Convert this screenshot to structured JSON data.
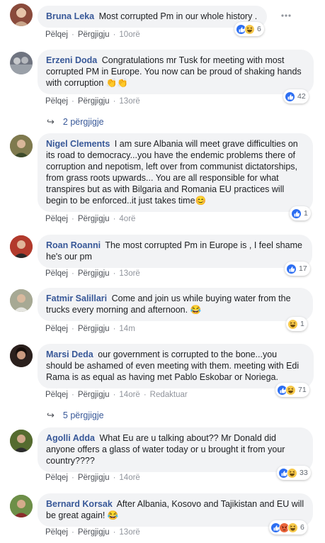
{
  "actions": {
    "like": "Pëlqej",
    "reply": "Përgjigju",
    "edited": "Redaktuar"
  },
  "comments": [
    {
      "author": "Bruna Leka",
      "text": "Most corrupted Pm in our whole history .",
      "time": "10orë",
      "reactions": [
        "like",
        "haha"
      ],
      "count": "6",
      "avatar_color": "#8a4a3b"
    },
    {
      "author": "Erzeni Doda",
      "text": "Congratulations mr Tusk for meeting with most corrupted PM in Europe. You now can be proud of shaking hands with corruption 👏👏",
      "time": "13orë",
      "reactions": [
        "like"
      ],
      "count": "42",
      "avatar_color": "#6f7480",
      "replies": "2 përgjigje"
    },
    {
      "author": "Nigel Clements",
      "text": "I am sure Albania will meet grave difficulties on its road to democracy...you have the endemic problems there of corruption and nepotism, left over from communist dictatorships, from grass roots upwards... You are all responsible for what transpires but as with Bilgaria and Romania EU practices will begin to be enforced..it just takes time😊",
      "time": "4orë",
      "reactions": [
        "like"
      ],
      "count": "1",
      "avatar_color": "#5d5a3c"
    },
    {
      "author": "Roan Roanni",
      "text": "The most corrupted Pm in Europe is , I feel shame he's our pm",
      "time": "13orë",
      "reactions": [
        "like"
      ],
      "count": "17",
      "avatar_color": "#a32a22"
    },
    {
      "author": "Fatmir Salillari",
      "text": "Come and join us while buying water from the trucks every morning and afternoon. 😂",
      "time": "14m",
      "reactions": [
        "haha"
      ],
      "count": "1",
      "avatar_color": "#8c8f7a"
    },
    {
      "author": "Marsi Deda",
      "text": "our government is corrupted to the bone...you should be ashamed of even meeting with them. meeting with Edi Rama is as equal as having met Pablo Eskobar or Noriega.",
      "time": "14orë",
      "edited": true,
      "reactions": [
        "like",
        "haha"
      ],
      "count": "71",
      "avatar_color": "#3a2a26",
      "replies": "5 përgjigje"
    },
    {
      "author": "Agolli Adda",
      "text": "What Eu are u talking about?? Mr Donald did anyone offers a glass of water today or u brought it from your country????",
      "time": "14orë",
      "reactions": [
        "like",
        "haha"
      ],
      "count": "33",
      "avatar_color": "#4a5a2c"
    },
    {
      "author": "Bernard Korsak",
      "text": "After Albania, Kosovo and Tajikistan and EU will be great again! 😂",
      "time": "13orë",
      "reactions": [
        "like",
        "angry",
        "haha"
      ],
      "count": "6",
      "avatar_color": "#5a7a3c"
    }
  ]
}
